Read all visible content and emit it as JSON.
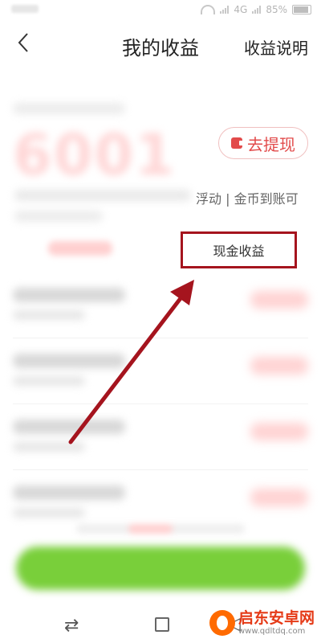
{
  "status_bar": {
    "network": "4G",
    "battery": "85%"
  },
  "header": {
    "back_icon": "chevron-left-icon",
    "title": "我的收益",
    "explain_label": "收益说明"
  },
  "summary": {
    "amount": "6001",
    "withdraw_label": "去提现",
    "note_visible": "浮动 | 金币到账可"
  },
  "tabs": {
    "cash_label": "现金收益"
  },
  "watermark": {
    "name": "启东安卓网",
    "url": "www.qdltdq.com"
  },
  "colors": {
    "highlight_border": "#a5141e",
    "arrow": "#a5141e",
    "accent_red": "#e24b4b",
    "green_button": "#79cf3a"
  }
}
